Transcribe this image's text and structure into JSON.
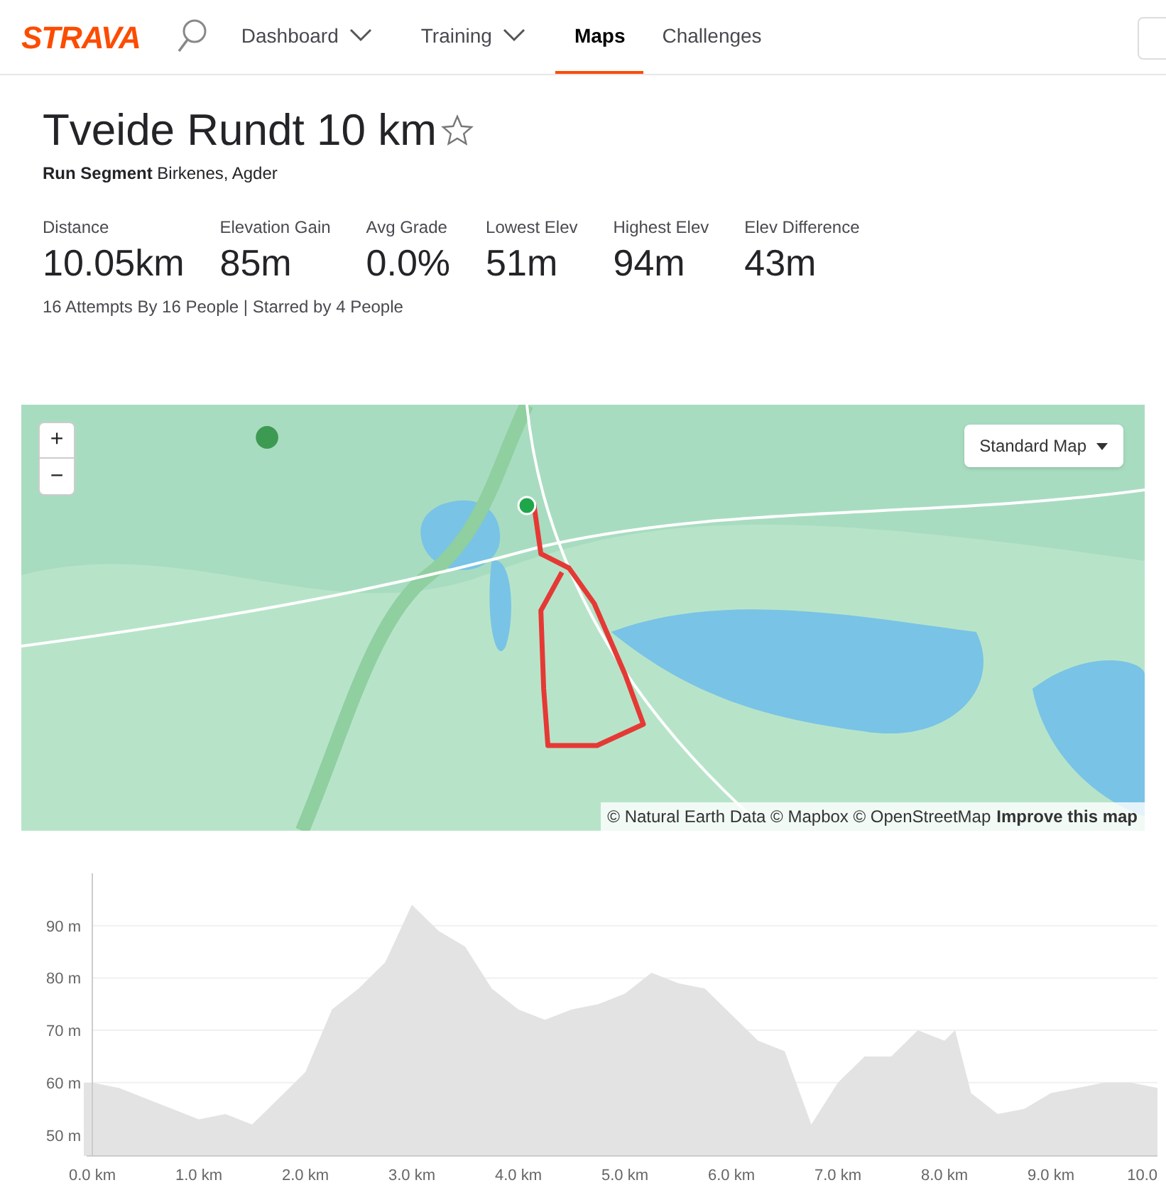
{
  "nav": {
    "logo": "STRAVA",
    "items": [
      {
        "label": "Dashboard",
        "dropdown": true,
        "selected": false
      },
      {
        "label": "Training",
        "dropdown": true,
        "selected": false
      },
      {
        "label": "Maps",
        "dropdown": false,
        "selected": true
      },
      {
        "label": "Challenges",
        "dropdown": false,
        "selected": false
      }
    ]
  },
  "segment": {
    "title": "Tveide Rundt 10 km",
    "starred": false,
    "subtitle": "**Run Segment** Birkenes, Agder",
    "stats": [
      {
        "label": "Distance",
        "value": "10.05km"
      },
      {
        "label": "Elevation Gain",
        "value": "85m"
      },
      {
        "label": "Avg Grade",
        "value": "0.0%"
      },
      {
        "label": "Lowest Elev",
        "value": "51m"
      },
      {
        "label": "Highest Elev",
        "value": "94m"
      },
      {
        "label": "Elev Difference",
        "value": "43m"
      }
    ],
    "attempts": "16 Attempts By 16 People | Starred by 4 People"
  },
  "map": {
    "kind": "picture",
    "zoom_in": "+",
    "zoom_out": "−",
    "style_button": "Standard Map",
    "attribution": "© Natural Earth Data © Mapbox © OpenStreetMap",
    "improve_link": "Improve this map"
  },
  "elevation": {
    "chart_data": {
      "type": "area",
      "ylim": [
        46,
        100
      ],
      "xlim": [
        0,
        10
      ],
      "x": [
        0,
        0.25,
        0.5,
        0.75,
        1.0,
        1.25,
        1.5,
        1.75,
        2.0,
        2.25,
        2.5,
        2.75,
        3.0,
        3.25,
        3.5,
        3.75,
        4.0,
        4.25,
        4.5,
        4.75,
        5.0,
        5.25,
        5.5,
        5.75,
        6.0,
        6.25,
        6.5,
        6.75,
        7.0,
        7.25,
        7.5,
        7.75,
        8.0,
        8.1,
        8.25,
        8.5,
        8.75,
        9.0,
        9.25,
        9.5,
        9.75,
        10.0
      ],
      "grid": true,
      "series": [
        {
          "color": "#e3e3e3",
          "values": [
            60,
            59,
            57,
            55,
            53,
            54,
            52,
            57,
            62,
            74,
            78,
            83,
            94,
            89,
            86,
            78,
            74,
            72,
            74,
            75,
            77,
            81,
            79,
            78,
            73,
            68,
            66,
            52,
            60,
            65,
            65,
            70,
            68,
            70,
            58,
            54,
            55,
            58,
            59,
            60,
            60,
            59
          ]
        }
      ],
      "yticks": [
        {
          "value": 50,
          "label": "50 m"
        },
        {
          "value": 60,
          "label": "60 m"
        },
        {
          "value": 70,
          "label": "70 m"
        },
        {
          "value": 80,
          "label": "80 m"
        },
        {
          "value": 90,
          "label": "90 m"
        }
      ],
      "xticks": [
        {
          "value": 0,
          "label": "0.0 km"
        },
        {
          "value": 1,
          "label": "1.0 km"
        },
        {
          "value": 2,
          "label": "2.0 km"
        },
        {
          "value": 3,
          "label": "3.0 km"
        },
        {
          "value": 4,
          "label": "4.0 km"
        },
        {
          "value": 5,
          "label": "5.0 km"
        },
        {
          "value": 6,
          "label": "6.0 km"
        },
        {
          "value": 7,
          "label": "7.0 km"
        },
        {
          "value": 8,
          "label": "8.0 km"
        },
        {
          "value": 9,
          "label": "9.0 km"
        },
        {
          "value": 10,
          "label": "10.0"
        }
      ]
    }
  }
}
